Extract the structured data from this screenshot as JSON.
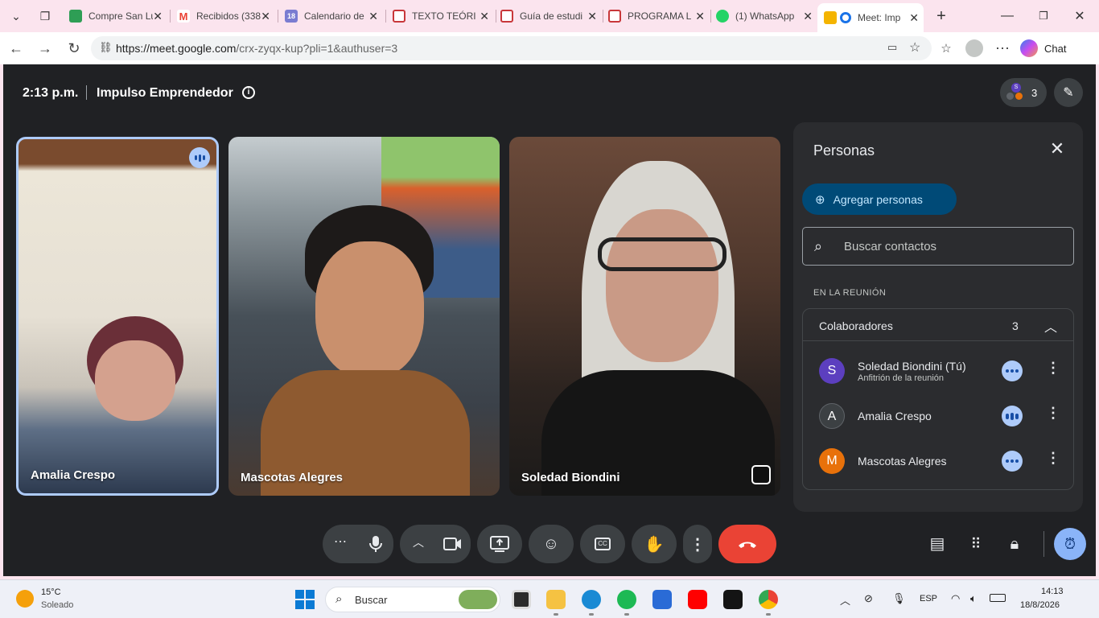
{
  "browser": {
    "tabs": [
      {
        "title": "Compre San Lu",
        "favicon_color": "#2e9e55"
      },
      {
        "title": "Recibidos (338",
        "favicon_color": "#ea4335"
      },
      {
        "title": "Calendario de",
        "favicon_color": "#7a7cd1"
      },
      {
        "title": "TEXTO TEÓRIC",
        "favicon_color": "#c8373a"
      },
      {
        "title": "Guía de estudi",
        "favicon_color": "#c8373a"
      },
      {
        "title": "PROGRAMA LI",
        "favicon_color": "#c8373a"
      },
      {
        "title": "(1) WhatsApp",
        "favicon_color": "#25d366"
      },
      {
        "title": "Meet: Imp",
        "favicon_color": "#f4b400"
      }
    ],
    "url_host": "https://meet.google.com",
    "url_rest": "/crx-zyqx-kup?pli=1&authuser=3",
    "chat_label": "Chat"
  },
  "meeting": {
    "time": "2:13 p.m.",
    "title": "Impulso Emprendedor",
    "participant_count": "3",
    "tiles": [
      {
        "name": "Amalia Crespo",
        "speaking": true
      },
      {
        "name": "Mascotas Alegres"
      },
      {
        "name": "Soledad Biondini"
      }
    ]
  },
  "people_panel": {
    "title": "Personas",
    "add_label": "Agregar personas",
    "search_placeholder": "Buscar contactos",
    "section_label": "EN LA REUNIÓN",
    "group_label": "Colaboradores",
    "group_count": "3",
    "people": [
      {
        "initial": "S",
        "name": "Soledad Biondini (Tú)",
        "subtitle": "Anfitrión de la reunión",
        "color": "#5c3fbf"
      },
      {
        "initial": "A",
        "name": "Amalia Crespo",
        "color": "#3c4043"
      },
      {
        "initial": "M",
        "name": "Mascotas Alegres",
        "color": "#e8710a"
      }
    ]
  },
  "taskbar": {
    "temperature": "15°C",
    "weather": "Soleado",
    "search_placeholder": "Buscar",
    "language": "ESP",
    "time": "14:13",
    "date": "18/8/2026"
  }
}
